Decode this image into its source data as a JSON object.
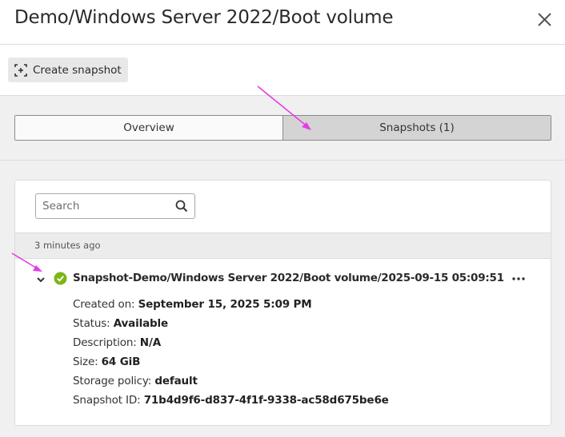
{
  "header": {
    "title": "Demo/Windows Server 2022/Boot volume",
    "close_icon": "close-icon"
  },
  "toolbar": {
    "create_snapshot_label": "Create snapshot",
    "create_snapshot_icon": "snapshot-icon"
  },
  "tabs": [
    {
      "label": "Overview",
      "active": false
    },
    {
      "label": "Snapshots (1)",
      "active": true
    }
  ],
  "search": {
    "placeholder": "Search",
    "value": ""
  },
  "groups": [
    {
      "header": "3 minutes ago",
      "snapshots": [
        {
          "name": "Snapshot-Demo/Windows Server 2022/Boot volume/2025-09-15 05:09:51",
          "status_icon": "check-circle-icon",
          "expanded": true,
          "details": [
            {
              "label": "Created on:",
              "value": "September 15, 2025 5:09 PM"
            },
            {
              "label": "Status:",
              "value": "Available"
            },
            {
              "label": "Description:",
              "value": "N/A"
            },
            {
              "label": "Size:",
              "value": "64 GiB"
            },
            {
              "label": "Storage policy:",
              "value": "default"
            },
            {
              "label": "Snapshot ID:",
              "value": "71b4d9f6-d837-4f1f-9338-ac58d675be6e"
            }
          ]
        }
      ]
    }
  ],
  "colors": {
    "accent_arrow": "#e53be6",
    "status_ok": "#7cb518",
    "active_tab": "#d4d4d4"
  }
}
